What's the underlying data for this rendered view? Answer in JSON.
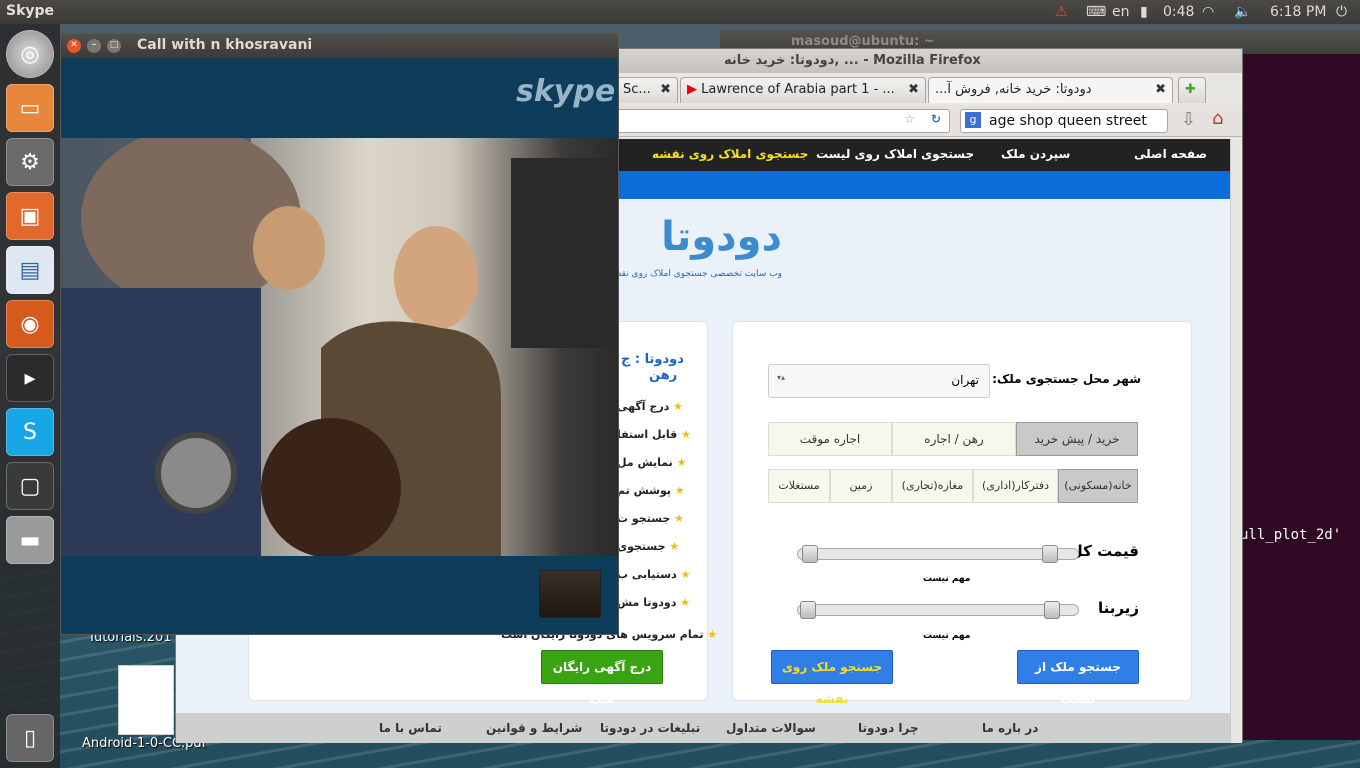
{
  "topbar": {
    "app_name": "Skype",
    "keyboard_layout": "en",
    "battery": "0:48",
    "clock": "6:18 PM"
  },
  "launcher": {
    "items": [
      "dash-home",
      "files",
      "system-settings",
      "software-center",
      "document-viewer",
      "firefox",
      "terminal",
      "skype",
      "workspace-switcher",
      "drive"
    ]
  },
  "terminal": {
    "title": "masoud@ubuntu: ~",
    "visible_text": "ull_plot_2d'"
  },
  "desktop": {
    "tutorials_label": "Tutorials.201",
    "pdf_label": "Android-1-0-CC.pdf"
  },
  "firefox": {
    "window_title": "دودوتا: خرید خانه, ... - Mozilla Firefox",
    "tabs": [
      {
        "label": "Sc..."
      },
      {
        "label": "Lawrence of Arabia part 1 - ..."
      },
      {
        "label": "...دودوتا: خرید خانه, فروش آ"
      }
    ],
    "search_text": "age shop queen street"
  },
  "site": {
    "nav": {
      "home": "صفحه اصلی",
      "submit": "سپردن ملک",
      "list_search": "جستجوی املاک روی لیست",
      "map_search": "جستجوی املاک روی نقشه"
    },
    "logo_name": "دودوتا",
    "logo_sub": "وب سایت تخصصی جستجوی املاک روی نقشه",
    "city_label": "شهر محل جستجوی ملک:",
    "city_value": "تهران",
    "deal_types": [
      "خرید / پیش خرید",
      "رهن / اجاره",
      "اجاره موقت"
    ],
    "property_types": [
      "خانه(مسکونی)",
      "دفترکار(اداری)",
      "مغازه(تجاری)",
      "زمین",
      "مستغلات"
    ],
    "price_label": "قیمت کل",
    "price_note": "مهم نیست",
    "area_label": "زیربنا",
    "area_note": "مهم نیست",
    "btn_list": "جستجو ملک از لیست",
    "btn_map": "جستجو ملک روی نقشه",
    "side_title_1": "دودوتا : ج",
    "side_title_2": "رهن",
    "features": [
      "درج آگهی",
      "قابل استفا",
      "نمایش مل",
      "پوشش تم",
      "جستجو ت",
      "جستجوی",
      "دستیابی ب",
      "دودوتا مش",
      "تمام سرویس های دودوتا رایگان است"
    ],
    "btn_free_ad": "درج آگهی رایگان ملک",
    "footer": [
      "در باره ما",
      "چرا دودوتا",
      "سوالات متداول",
      "تبلیغات در دودوتا",
      "شرایط و قوانین",
      "تماس با ما"
    ]
  },
  "skype": {
    "window_title": "Call with n khosravani",
    "logo_text": "skype"
  }
}
